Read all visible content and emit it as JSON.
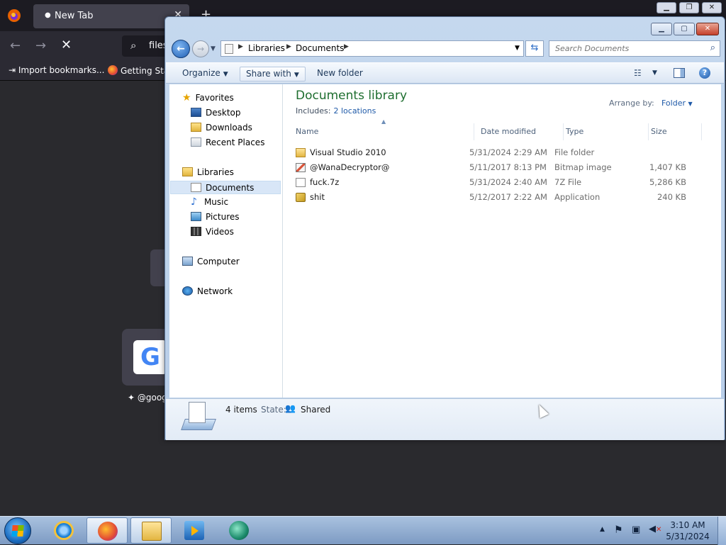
{
  "firefox": {
    "tab_title": "New Tab",
    "url_text": "files",
    "bookmarks": [
      "Import bookmarks...",
      "Getting Star"
    ],
    "shortcut_label": "@goog"
  },
  "explorer": {
    "address_crumbs": [
      "Libraries",
      "Documents"
    ],
    "search_placeholder": "Search Documents",
    "toolbar": {
      "organize": "Organize",
      "share_with": "Share with",
      "new_folder": "New folder"
    },
    "nav": {
      "favorites": "Favorites",
      "desktop": "Desktop",
      "downloads": "Downloads",
      "recent_places": "Recent Places",
      "libraries": "Libraries",
      "documents": "Documents",
      "music": "Music",
      "pictures": "Pictures",
      "videos": "Videos",
      "computer": "Computer",
      "network": "Network"
    },
    "library": {
      "title": "Documents library",
      "includes_label": "Includes:",
      "includes_link": "2 locations",
      "arrange_label": "Arrange by:",
      "arrange_value": "Folder"
    },
    "columns": {
      "name": "Name",
      "date": "Date modified",
      "type": "Type",
      "size": "Size"
    },
    "files": [
      {
        "name": "Visual Studio 2010",
        "date": "5/31/2024 2:29 AM",
        "type": "File folder",
        "size": "",
        "icon": "folder-icon"
      },
      {
        "name": "@WanaDecryptor@",
        "date": "5/11/2017 8:13 PM",
        "type": "Bitmap image",
        "size": "1,407 KB",
        "icon": "bitmap-icon"
      },
      {
        "name": "fuck.7z",
        "date": "5/31/2024 2:40 AM",
        "type": "7Z File",
        "size": "5,286 KB",
        "icon": "file-icon"
      },
      {
        "name": "shit",
        "date": "5/12/2017 2:22 AM",
        "type": "Application",
        "size": "240 KB",
        "icon": "application-icon"
      }
    ],
    "details": {
      "count": "4 items",
      "state_label": "State:",
      "state_value": "Shared"
    }
  },
  "taskbar": {
    "time": "3:10 AM",
    "date": "5/31/2024"
  }
}
